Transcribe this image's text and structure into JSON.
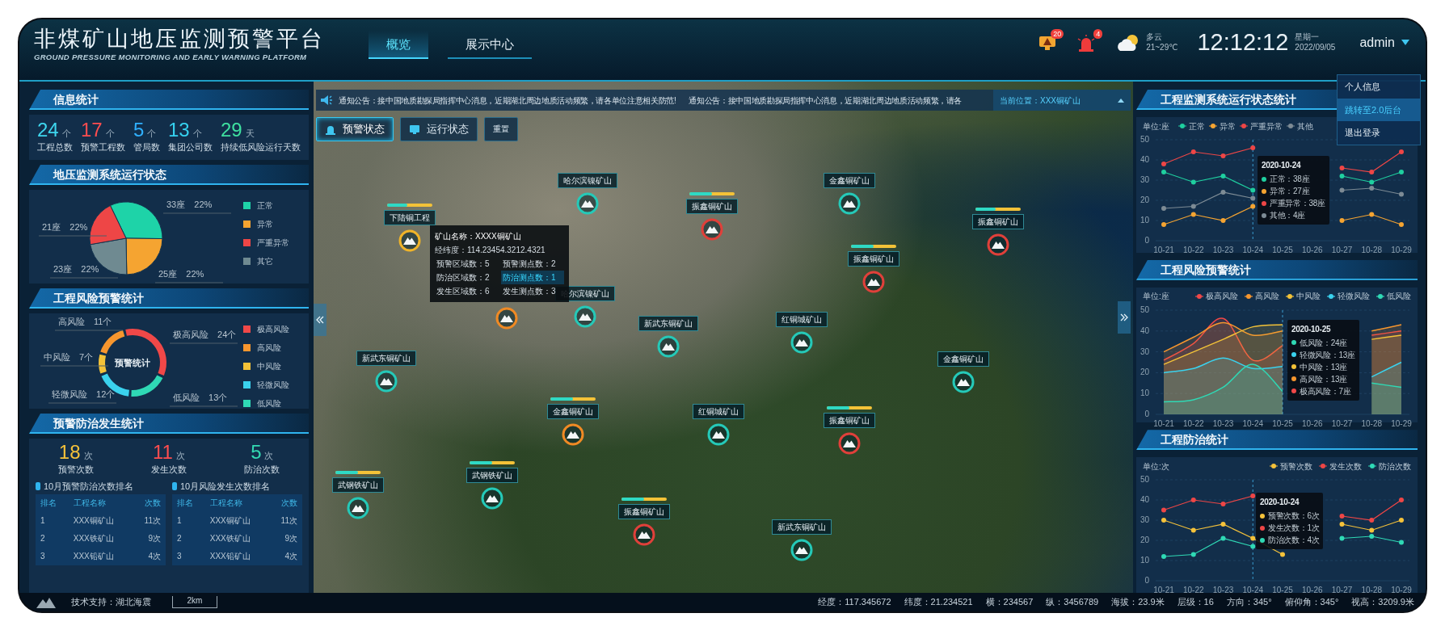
{
  "header": {
    "title": "非煤矿山地压监测预警平台",
    "subtitle": "GROUND PRESSURE MONITORING AND EARLY WARNING PLATFORM",
    "tabs": [
      {
        "label": "概览",
        "selected": true
      },
      {
        "label": "展示中心",
        "selected": false
      }
    ],
    "alerts": [
      {
        "kind": "monitor",
        "badge": "20"
      },
      {
        "kind": "siren",
        "badge": "4"
      }
    ],
    "weather": {
      "condition": "多云",
      "temperature": "21~29℃"
    },
    "clock": {
      "time": "12:12:12",
      "weekday": "星期一",
      "date": "2022/09/05"
    },
    "user": {
      "name": "admin",
      "expanded": true,
      "menu": [
        {
          "label": "个人信息",
          "selected": false
        },
        {
          "label": "跳转至2.0后台",
          "selected": true
        },
        {
          "label": "退出登录",
          "selected": false
        }
      ]
    }
  },
  "left_panel": {
    "info_stats": {
      "title": "信息统计",
      "items": [
        {
          "value": "24",
          "unit": "个",
          "label": "工程总数",
          "color": "#3ed6ee"
        },
        {
          "value": "17",
          "unit": "个",
          "label": "预警工程数",
          "color": "#ff4d4f"
        },
        {
          "value": "5",
          "unit": "个",
          "label": "管局数",
          "color": "#2fb0ff"
        },
        {
          "value": "13",
          "unit": "个",
          "label": "集团公司数",
          "color": "#36d2f0"
        },
        {
          "value": "29",
          "unit": "天",
          "label": "持续低风险运行天数",
          "color": "#3fe0a0"
        }
      ]
    },
    "system_status": {
      "title": "地压监测系统运行状态",
      "chart_data": {
        "type": "pie",
        "categories": [
          "正常",
          "异常",
          "严重异常",
          "其它"
        ],
        "values": [
          33,
          25,
          21,
          23
        ],
        "colors": [
          "#1ed3a8",
          "#f5a431",
          "#ee4646",
          "#6f8a91"
        ],
        "legend": "right",
        "value_labels": [
          "33座 22%",
          "25座 22%",
          "21座 22%",
          "23座 22%"
        ]
      }
    },
    "risk_warning": {
      "title": "工程风险预警统计",
      "center_label": "预警统计",
      "chart_data": {
        "type": "donut",
        "categories": [
          "极高风险",
          "高风险",
          "中风险",
          "轻微风险",
          "低风险"
        ],
        "values": [
          24,
          11,
          7,
          12,
          13
        ],
        "colors": [
          "#f04848",
          "#f6962e",
          "#f3c238",
          "#3ad2ee",
          "#2fd9b5"
        ],
        "legend": "right",
        "value_labels": [
          "极高风险 24个",
          "高风险 11个",
          "中风险 7个",
          "轻微风险 12个",
          "低风险 13个"
        ]
      }
    },
    "prevention": {
      "title": "预警防治发生统计",
      "items": [
        {
          "value": "18",
          "unit": "次",
          "label": "预警次数",
          "color": "#f5c23a"
        },
        {
          "value": "11",
          "unit": "次",
          "label": "发生次数",
          "color": "#ff4d4f"
        },
        {
          "value": "5",
          "unit": "次",
          "label": "防治次数",
          "color": "#33d9b2"
        }
      ],
      "rankings": [
        {
          "title": "10月预警防治次数排名",
          "columns": [
            "排名",
            "工程名称",
            "次数"
          ],
          "rows": [
            [
              "1",
              "XXX铜矿山",
              "11次"
            ],
            [
              "2",
              "XXX铁矿山",
              "9次"
            ],
            [
              "3",
              "XXX铅矿山",
              "4次"
            ]
          ]
        },
        {
          "title": "10月风险发生次数排名",
          "columns": [
            "排名",
            "工程名称",
            "次数"
          ],
          "rows": [
            [
              "1",
              "XXX铜矿山",
              "11次"
            ],
            [
              "2",
              "XXX铁矿山",
              "9次"
            ],
            [
              "3",
              "XXX铅矿山",
              "4次"
            ]
          ]
        }
      ]
    }
  },
  "map": {
    "notices": [
      "通知公告：接中国地质勘探局指挥中心消息，近期湖北周边地质活动频繁，请各单位注意相关防范!",
      "通知公告：接中国地质勘探局指挥中心消息，近期湖北周边地质活动频繁，请各"
    ],
    "location": "当前位置：XXX铜矿山",
    "controls": [
      {
        "kind": "alarm",
        "label": "预警状态",
        "selected": true
      },
      {
        "kind": "monitor",
        "label": "运行状态",
        "selected": false
      },
      {
        "kind": "plain",
        "label": "重置",
        "selected": false
      }
    ],
    "markers": [
      {
        "label": "下陆铜工程",
        "color": "#f0b429",
        "level": 0.45
      },
      {
        "label": "哈尔滨镍矿山",
        "color": "#25c9b8"
      },
      {
        "label": "振鑫铜矿山",
        "color": "#e0403a",
        "level": 0.5
      },
      {
        "label": "金鑫铜矿山",
        "color": "#25c9b8"
      },
      {
        "label": "振鑫铜矿山",
        "color": "#e0403a",
        "level": 0.45
      },
      {
        "label": "振鑫铜矿山",
        "color": "#e0403a",
        "level": 0.5
      },
      {
        "label": "哈尔滨镍矿山",
        "color": "#25c9b8"
      },
      {
        "color": "#f08a24"
      },
      {
        "label": "新武东铜矿山",
        "color": "#25c9b8"
      },
      {
        "label": "红铜城矿山",
        "color": "#25c9b8"
      },
      {
        "label": "新武东铜矿山",
        "color": "#25c9b8"
      },
      {
        "label": "金鑫铜矿山",
        "color": "#25c9b8"
      },
      {
        "label": "金鑫铜矿山",
        "color": "#f08a24",
        "level": 0.5
      },
      {
        "label": "红铜城矿山",
        "color": "#25c9b8"
      },
      {
        "label": "振鑫铜矿山",
        "color": "#e0403a",
        "level": 0.5
      },
      {
        "label": "武钢铁矿山",
        "color": "#25c9b8",
        "level": 0.5
      },
      {
        "label": "武钢铁矿山",
        "color": "#25c9b8",
        "level": 0.5
      },
      {
        "label": "振鑫铜矿山",
        "color": "#e0403a",
        "level": 0.5
      },
      {
        "label": "新武东铜矿山",
        "color": "#25c9b8"
      }
    ],
    "popup": {
      "name": "矿山名称：XXXX铜矿山",
      "coords": "经纬度：114.23454.3212.4321",
      "stats": [
        {
          "text": "预警区域数：5",
          "selected": false
        },
        {
          "text": "预警测点数：2",
          "selected": false
        },
        {
          "text": "防治区域数：2",
          "selected": false
        },
        {
          "text": "防治测点数：1",
          "selected": true
        },
        {
          "text": "发生区域数：6",
          "selected": false
        },
        {
          "text": "发生测点数：3",
          "selected": false
        }
      ]
    }
  },
  "right_panel": [
    {
      "title": "工程监测系统运行状态统计",
      "unit": "单位:座",
      "chart_data": {
        "type": "line",
        "categories": [
          "10-21",
          "10-22",
          "10-23",
          "10-24",
          "10-25",
          "10-26",
          "10-27",
          "10-28",
          "10-29"
        ],
        "ylim": [
          0,
          50
        ],
        "yticks": [
          0,
          10,
          20,
          30,
          40,
          50
        ],
        "grid": true,
        "legend": "top",
        "ref_lines": [
          {
            "axis": "x",
            "value": "10-24"
          }
        ],
        "series": [
          {
            "name": "正常",
            "color": "#1fcf9f",
            "marker": "circle",
            "values": [
              34,
              29,
              32,
              25,
              null,
              null,
              32,
              29,
              34
            ]
          },
          {
            "name": "异常",
            "color": "#f5a431",
            "marker": "circle",
            "values": [
              8,
              13,
              10,
              17,
              null,
              null,
              10,
              13,
              8
            ]
          },
          {
            "name": "严重异常",
            "color": "#ee4646",
            "marker": "circle",
            "values": [
              38,
              44,
              42,
              46,
              null,
              null,
              36,
              34,
              44
            ]
          },
          {
            "name": "其他",
            "color": "#7d8b95",
            "marker": "circle",
            "values": [
              16,
              17,
              24,
              21,
              null,
              null,
              25,
              26,
              23
            ]
          }
        ]
      },
      "tooltip": {
        "title": "2020-10-24",
        "rows": [
          {
            "text": "正常：38座",
            "color": "#1fcf9f"
          },
          {
            "text": "异常：27座",
            "color": "#f5a431"
          },
          {
            "text": "严重异常：38座",
            "color": "#ee4646"
          },
          {
            "text": "其他：4座",
            "color": "#7d8b95"
          }
        ]
      }
    },
    {
      "title": "工程风险预警统计",
      "unit": "单位:座",
      "chart_data": {
        "type": "area",
        "categories": [
          "10-21",
          "10-22",
          "10-23",
          "10-24",
          "10-25",
          "10-26",
          "10-27",
          "10-28",
          "10-29"
        ],
        "ylim": [
          0,
          50
        ],
        "yticks": [
          0,
          10,
          20,
          30,
          40,
          50
        ],
        "grid": true,
        "legend": "top",
        "ref_lines": [
          {
            "axis": "x",
            "value": "10-25"
          }
        ],
        "series": [
          {
            "name": "极高风险",
            "color": "#f04848",
            "values": [
              26,
              34,
              46,
              26,
              33,
              null,
              null,
              38,
              40
            ]
          },
          {
            "name": "高风险",
            "color": "#f6962e",
            "values": [
              30,
              37,
              44,
              38,
              40,
              null,
              null,
              40,
              43
            ]
          },
          {
            "name": "中风险",
            "color": "#f3c238",
            "values": [
              24,
              30,
              36,
              42,
              43,
              null,
              null,
              36,
              38
            ]
          },
          {
            "name": "轻微风险",
            "color": "#3ad2ee",
            "values": [
              20,
              22,
              27,
              22,
              23,
              null,
              null,
              18,
              25
            ]
          },
          {
            "name": "低风险",
            "color": "#2fd9b5",
            "values": [
              6,
              7,
              13,
              24,
              11,
              null,
              null,
              15,
              13
            ]
          }
        ]
      },
      "tooltip": {
        "title": "2020-10-25",
        "rows": [
          {
            "text": "低风险：24座",
            "color": "#2fd9b5"
          },
          {
            "text": "轻微风险：13座",
            "color": "#3ad2ee"
          },
          {
            "text": "中风险：13座",
            "color": "#f3c238"
          },
          {
            "text": "高风险：13座",
            "color": "#f6962e"
          },
          {
            "text": "极高风险：7座",
            "color": "#f04848"
          }
        ]
      }
    },
    {
      "title": "工程防治统计",
      "unit": "单位:次",
      "chart_data": {
        "type": "line",
        "categories": [
          "10-21",
          "10-22",
          "10-23",
          "10-24",
          "10-25",
          "10-26",
          "10-27",
          "10-28",
          "10-29"
        ],
        "ylim": [
          0,
          50
        ],
        "yticks": [
          0,
          10,
          20,
          30,
          40,
          50
        ],
        "grid": true,
        "legend": "top",
        "ref_lines": [
          {
            "axis": "x",
            "value": "10-24"
          }
        ],
        "series": [
          {
            "name": "预警次数",
            "color": "#f5c23a",
            "marker": "circle",
            "values": [
              30,
              25,
              28,
              21,
              13,
              null,
              28,
              25,
              30
            ]
          },
          {
            "name": "发生次数",
            "color": "#ee4646",
            "marker": "circle",
            "values": [
              35,
              40,
              38,
              42,
              null,
              null,
              32,
              30,
              40
            ]
          },
          {
            "name": "防治次数",
            "color": "#2fd9b5",
            "marker": "circle",
            "values": [
              12,
              13,
              21,
              17,
              null,
              null,
              21,
              22,
              19
            ]
          }
        ]
      },
      "tooltip": {
        "title": "2020-10-24",
        "rows": [
          {
            "text": "预警次数：6次",
            "color": "#f5c23a"
          },
          {
            "text": "发生次数：1次",
            "color": "#ee4646"
          },
          {
            "text": "防治次数：4次",
            "color": "#2fd9b5"
          }
        ]
      }
    }
  ],
  "footer": {
    "support": "技术支持：湖北海震",
    "scale": "2km",
    "readouts": [
      "经度：117.345672",
      "纬度：21.234521",
      "横：234567",
      "纵：3456789",
      "海拔：23.9米",
      "层级：16",
      "方向：345°",
      "俯仰角：345°",
      "视高：3209.9米"
    ]
  }
}
